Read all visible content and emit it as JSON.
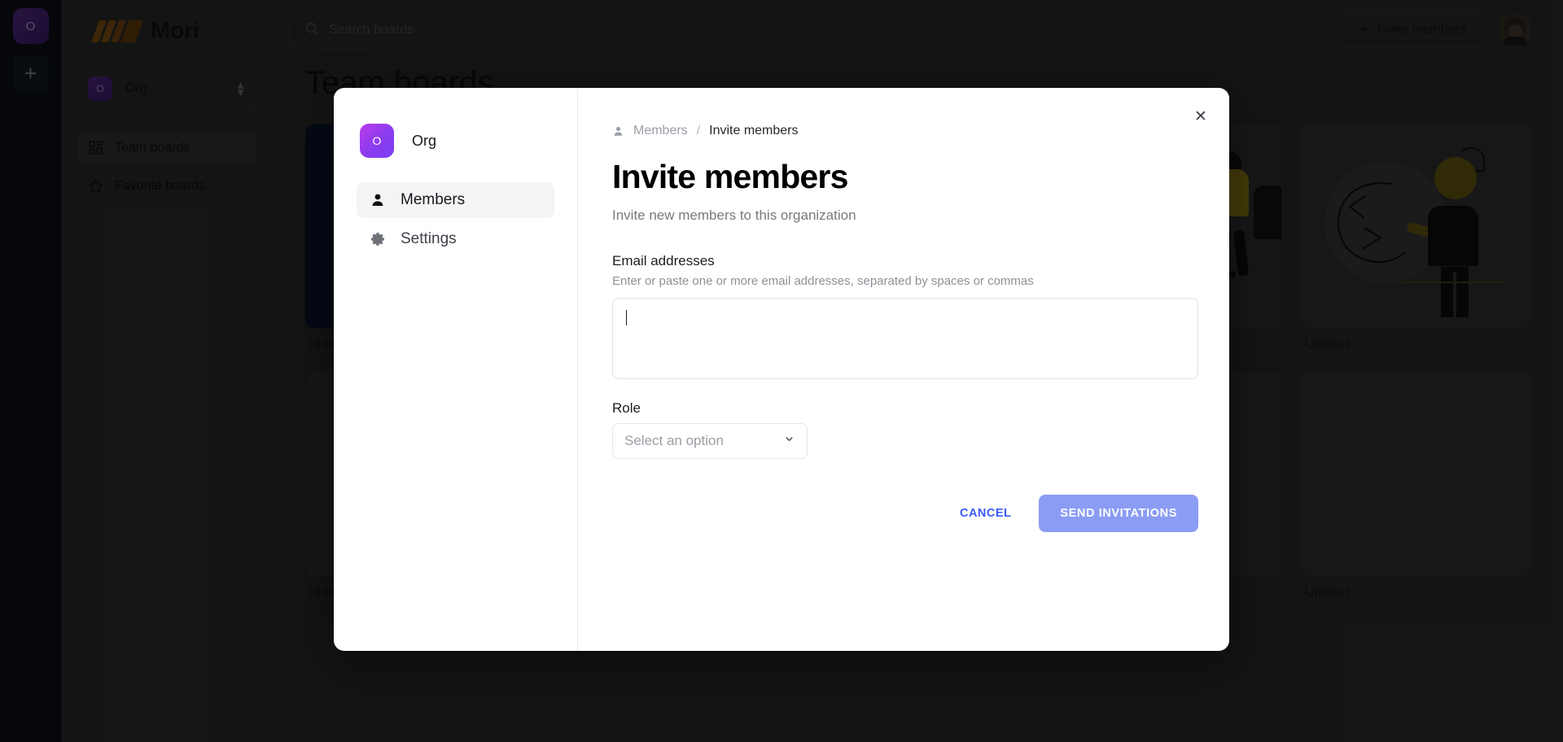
{
  "app": {
    "rail": {
      "org_initial": "O",
      "add_label": "+"
    },
    "brand": {
      "name": "Mori"
    },
    "org_switcher": {
      "initial": "O",
      "name": "Org"
    },
    "nav": [
      {
        "label": "Team boards",
        "icon": "grid-icon",
        "active": true
      },
      {
        "label": "Favorite boards",
        "icon": "star-icon",
        "active": false
      }
    ],
    "search": {
      "placeholder": "Search boards",
      "value": ""
    },
    "invite_button": {
      "label": "Invite members",
      "plus": "+"
    },
    "page_title": "Team boards",
    "cards": [
      {
        "label": "Untitled",
        "style": "navy"
      },
      {
        "label": "Untitled",
        "style": "illustration-a"
      },
      {
        "label": "Untitled",
        "style": "illustration-b"
      }
    ],
    "bottom_card_label": "Untitled"
  },
  "modal": {
    "close_label": "✕",
    "sidebar": {
      "org": {
        "initial": "O",
        "name": "Org"
      },
      "items": [
        {
          "label": "Members",
          "icon": "person-icon",
          "active": true
        },
        {
          "label": "Settings",
          "icon": "gear-icon",
          "active": false
        }
      ]
    },
    "breadcrumb": {
      "parent": "Members",
      "separator": "/",
      "current": "Invite members"
    },
    "title": "Invite members",
    "subtitle": "Invite new members to this organization",
    "fields": {
      "email": {
        "label": "Email addresses",
        "help": "Enter or paste one or more email addresses, separated by spaces or commas",
        "value": ""
      },
      "role": {
        "label": "Role",
        "placeholder": "Select an option",
        "value": ""
      }
    },
    "actions": {
      "cancel": "CANCEL",
      "submit": "SEND INVITATIONS"
    }
  },
  "colors": {
    "accent_blue": "#3b5bfd",
    "submit_bg": "#8b9cf5",
    "org_gradient_start": "#b83dea",
    "org_gradient_end": "#7c3ef2",
    "app_bg": "#2e2e2e",
    "rail_bg": "#0d1117",
    "navy_card": "#0a1630"
  }
}
